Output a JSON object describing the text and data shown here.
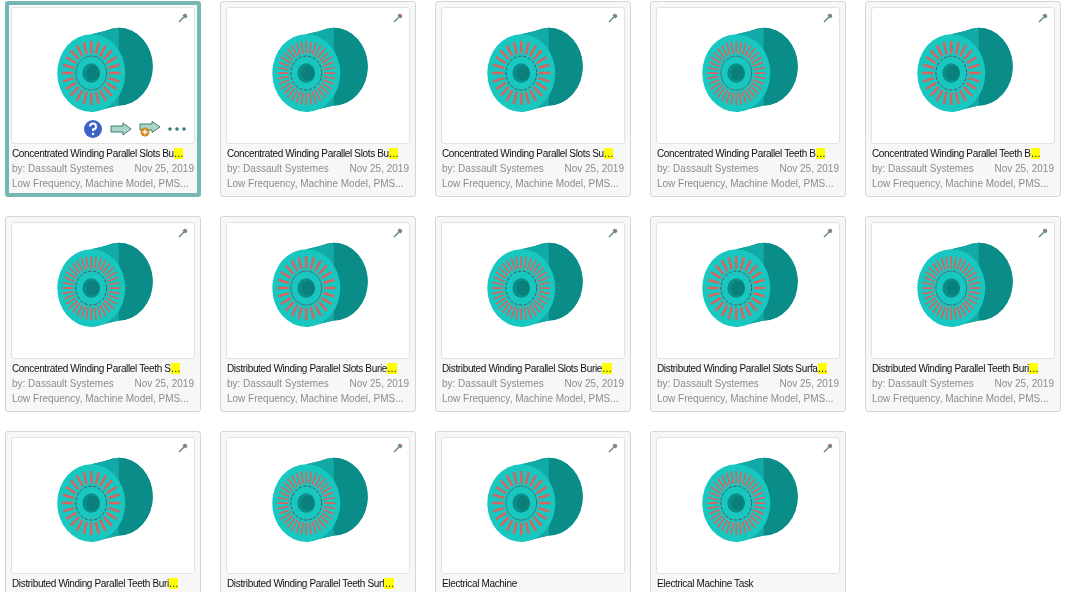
{
  "cards": [
    {
      "title": "Concentrated Winding Parallel Slots Bu",
      "truncation": "…",
      "author": "by: Dassault Systemes",
      "date": "Nov 25, 2019",
      "tags": "Low Frequency, Machine Model, PMS...",
      "selected": true
    },
    {
      "title": "Concentrated Winding Parallel Slots Bu",
      "truncation": "…",
      "author": "by: Dassault Systemes",
      "date": "Nov 25, 2019",
      "tags": "Low Frequency, Machine Model, PMS...",
      "selected": false
    },
    {
      "title": "Concentrated Winding Parallel Slots Su",
      "truncation": "…",
      "author": "by: Dassault Systemes",
      "date": "Nov 25, 2019",
      "tags": "Low Frequency, Machine Model, PMS...",
      "selected": false
    },
    {
      "title": "Concentrated Winding Parallel Teeth B",
      "truncation": "…",
      "author": "by: Dassault Systemes",
      "date": "Nov 25, 2019",
      "tags": "Low Frequency, Machine Model, PMS...",
      "selected": false
    },
    {
      "title": "Concentrated Winding Parallel Teeth B",
      "truncation": "…",
      "author": "by: Dassault Systemes",
      "date": "Nov 25, 2019",
      "tags": "Low Frequency, Machine Model, PMS...",
      "selected": false
    },
    {
      "title": "Concentrated Winding Parallel Teeth S",
      "truncation": "…",
      "author": "by: Dassault Systemes",
      "date": "Nov 25, 2019",
      "tags": "Low Frequency, Machine Model, PMS...",
      "selected": false
    },
    {
      "title": "Distributed Winding Parallel Slots Burie",
      "truncation": "…",
      "author": "by: Dassault Systemes",
      "date": "Nov 25, 2019",
      "tags": "Low Frequency, Machine Model, PMS...",
      "selected": false
    },
    {
      "title": "Distributed Winding Parallel Slots Burie",
      "truncation": "…",
      "author": "by: Dassault Systemes",
      "date": "Nov 25, 2019",
      "tags": "Low Frequency, Machine Model, PMS...",
      "selected": false
    },
    {
      "title": "Distributed Winding Parallel Slots Surfa",
      "truncation": "…",
      "author": "by: Dassault Systemes",
      "date": "Nov 25, 2019",
      "tags": "Low Frequency, Machine Model, PMS...",
      "selected": false
    },
    {
      "title": "Distributed Winding Parallel Teeth Buri",
      "truncation": "…",
      "author": "by: Dassault Systemes",
      "date": "Nov 25, 2019",
      "tags": "Low Frequency, Machine Model, PMS...",
      "selected": false
    },
    {
      "title": "Distributed Winding Parallel Teeth Buri",
      "truncation": "…",
      "selected": false
    },
    {
      "title": "Distributed Winding Parallel Teeth Surf",
      "truncation": "…",
      "selected": false
    },
    {
      "title": "Electrical Machine",
      "selected": false
    },
    {
      "title": "Electrical Machine Task",
      "selected": false
    }
  ]
}
